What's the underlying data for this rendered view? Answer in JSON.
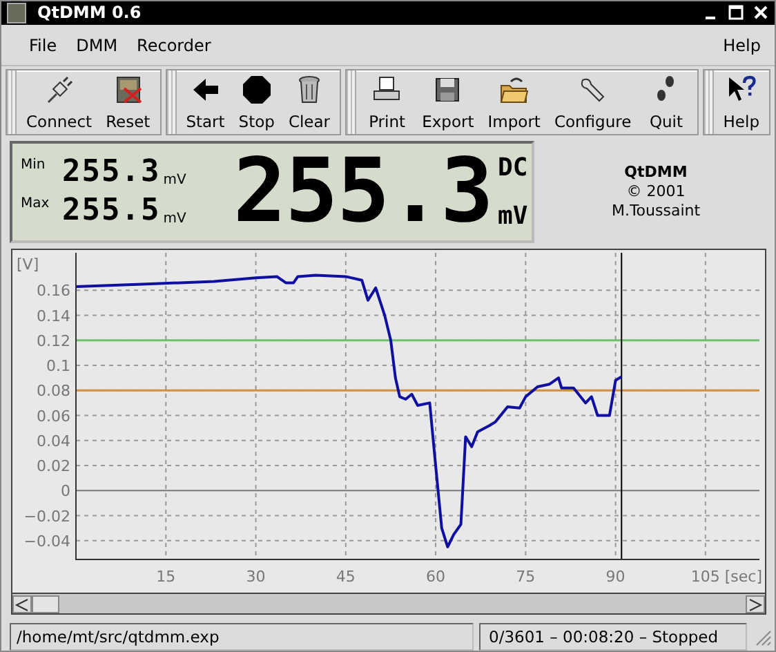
{
  "window": {
    "title": "QtDMM 0.6"
  },
  "menu": [
    {
      "label": "File"
    },
    {
      "label": "DMM"
    },
    {
      "label": "Recorder"
    },
    {
      "label": "Help"
    }
  ],
  "toolbar": [
    {
      "label": "Connect"
    },
    {
      "label": "Reset"
    },
    {
      "label": "Start"
    },
    {
      "label": "Stop"
    },
    {
      "label": "Clear"
    },
    {
      "label": "Print"
    },
    {
      "label": "Export"
    },
    {
      "label": "Import"
    },
    {
      "label": "Configure"
    },
    {
      "label": "Quit"
    },
    {
      "label": "Help"
    }
  ],
  "display": {
    "min_label": "Min",
    "min_value": "255.3",
    "min_unit": "mV",
    "max_label": "Max",
    "max_value": "255.5",
    "max_unit": "mV",
    "value": "255.3",
    "mode": "DC",
    "unit": "mV"
  },
  "about": {
    "name": "QtDMM",
    "copyright": "© 2001",
    "author": "M.Toussaint"
  },
  "chart": {
    "chart_data": {
      "type": "line",
      "ylabel": "[V]",
      "xlabel": "[sec]",
      "xlim": [
        0,
        114
      ],
      "ylim": [
        -0.055,
        0.19
      ],
      "xticks": [
        15,
        30,
        45,
        60,
        75,
        90,
        105
      ],
      "yticks": [
        {
          "value": 0.16,
          "label": "0.16"
        },
        {
          "value": 0.14,
          "label": "0.14"
        },
        {
          "value": 0.12,
          "label": "0.12"
        },
        {
          "value": 0.1,
          "label": "0.1"
        },
        {
          "value": 0.08,
          "label": "0.08"
        },
        {
          "value": 0.06,
          "label": "0.06"
        },
        {
          "value": 0.04,
          "label": "0.04"
        },
        {
          "value": 0.02,
          "label": "0.02"
        },
        {
          "value": 0,
          "label": "0"
        },
        {
          "value": -0.02,
          "label": "−0.02"
        },
        {
          "value": -0.04,
          "label": "−0.04"
        }
      ],
      "x": [
        0,
        11,
        23,
        30,
        33.5,
        35,
        36.3,
        37,
        40,
        45,
        47.7,
        48.7,
        50,
        51.5,
        52.5,
        53.3,
        54,
        55,
        56,
        57,
        59,
        60,
        61,
        62,
        63,
        64.2,
        65,
        66,
        67,
        69,
        70,
        72,
        74,
        75,
        77,
        79,
        80.5,
        81,
        83,
        85,
        86,
        87,
        89,
        90,
        91
      ],
      "grid": true,
      "series": [
        {
          "color": "#1010a0",
          "values": [
            0.163,
            0.165,
            0.167,
            0.17,
            0.171,
            0.166,
            0.166,
            0.171,
            0.172,
            0.171,
            0.168,
            0.152,
            0.162,
            0.14,
            0.12,
            0.09,
            0.075,
            0.073,
            0.077,
            0.068,
            0.07,
            0.02,
            -0.03,
            -0.045,
            -0.035,
            -0.027,
            0.043,
            0.035,
            0.047,
            0.052,
            0.055,
            0.067,
            0.066,
            0.075,
            0.083,
            0.085,
            0.09,
            0.082,
            0.082,
            0.07,
            0.075,
            0.06,
            0.06,
            0.088,
            0.091
          ]
        }
      ],
      "ref_lines": [
        {
          "axis": "y",
          "value": 0.12,
          "color": "#70c070"
        },
        {
          "axis": "y",
          "value": 0.08,
          "color": "#d09040"
        },
        {
          "axis": "x",
          "value": 91,
          "color": "#000000"
        }
      ]
    }
  },
  "status_bar": {
    "file": "/home/mt/src/qtdmm.exp",
    "progress": "0/3601  –  00:08:20  –  Stopped"
  }
}
